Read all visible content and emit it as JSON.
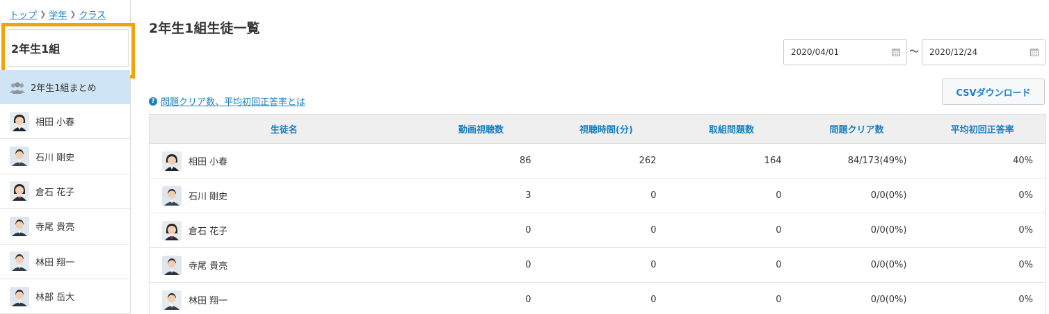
{
  "breadcrumb": [
    {
      "label": "トップ"
    },
    {
      "label": "学年"
    },
    {
      "label": "クラス"
    }
  ],
  "sidebar": {
    "class_name": "2年生1組",
    "summary_label": "2年生1組まとめ",
    "students": [
      {
        "name": "相田 小春",
        "gender": "f"
      },
      {
        "name": "石川 剛史",
        "gender": "m"
      },
      {
        "name": "倉石 花子",
        "gender": "f"
      },
      {
        "name": "寺尾 貴亮",
        "gender": "m"
      },
      {
        "name": "林田 翔一",
        "gender": "m"
      },
      {
        "name": "林部 岳大",
        "gender": "m"
      }
    ]
  },
  "main": {
    "title": "2年生1組生徒一覧",
    "date_from": "2020/04/01",
    "date_to": "2020/12/24",
    "date_separator": "〜",
    "help_link": "問題クリア数、平均初回正答率とは",
    "csv_button": "CSVダウンロード"
  },
  "table": {
    "headers": [
      "生徒名",
      "動画視聴数",
      "視聴時間(分)",
      "取組問題数",
      "問題クリア数",
      "平均初回正答率"
    ],
    "rows": [
      {
        "name": "相田 小春",
        "gender": "f",
        "videos": "86",
        "minutes": "262",
        "attempted": "164",
        "cleared": "84/173(49%)",
        "accuracy": "40%"
      },
      {
        "name": "石川 剛史",
        "gender": "m",
        "videos": "3",
        "minutes": "0",
        "attempted": "0",
        "cleared": "0/0(0%)",
        "accuracy": "0%"
      },
      {
        "name": "倉石 花子",
        "gender": "f",
        "videos": "0",
        "minutes": "0",
        "attempted": "0",
        "cleared": "0/0(0%)",
        "accuracy": "0%"
      },
      {
        "name": "寺尾 貴亮",
        "gender": "m",
        "videos": "0",
        "minutes": "0",
        "attempted": "0",
        "cleared": "0/0(0%)",
        "accuracy": "0%"
      },
      {
        "name": "林田 翔一",
        "gender": "m",
        "videos": "0",
        "minutes": "0",
        "attempted": "0",
        "cleared": "0/0(0%)",
        "accuracy": "0%"
      }
    ]
  },
  "colors": {
    "link": "#1a7fc1",
    "highlight_border": "#f0a30a",
    "summary_bg": "#cfe4f5"
  },
  "icons": {
    "group": "group-icon",
    "calendar": "calendar-icon",
    "help": "help-circle-icon",
    "breadcrumb_separator": "chevron-right-icon"
  }
}
